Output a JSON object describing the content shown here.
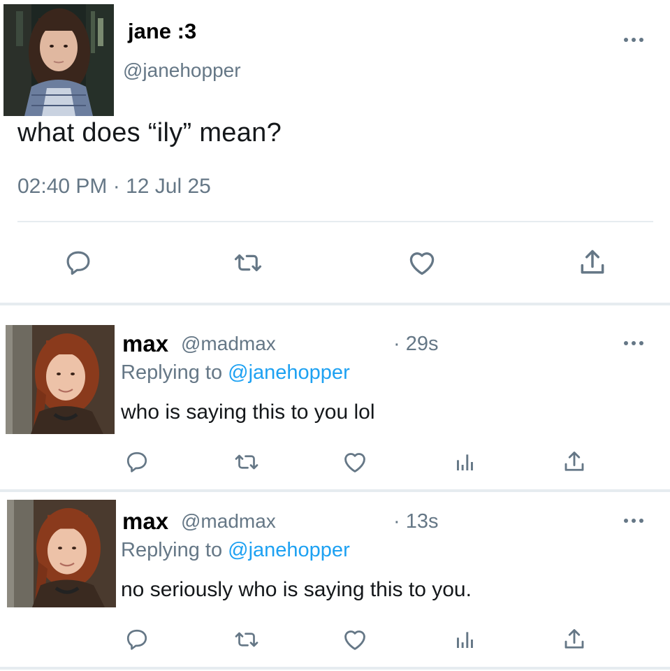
{
  "main_tweet": {
    "display_name": "jane :3",
    "handle": "@janehopper",
    "text": "what does “ily” mean?",
    "timestamp": "02:40 PM · 12 Jul 25",
    "more_icon": "more-dots-icon",
    "actions": [
      "reply-icon",
      "retweet-icon",
      "like-icon",
      "share-icon"
    ]
  },
  "replies": [
    {
      "display_name": "max",
      "handle": "@madmax",
      "time": "· 29s",
      "replying_prefix": "Replying to",
      "replying_handle": "@janehopper",
      "text": "who is saying this to you lol",
      "actions": [
        "reply-icon",
        "retweet-icon",
        "like-icon",
        "analytics-icon",
        "share-icon"
      ]
    },
    {
      "display_name": "max",
      "handle": "@madmax",
      "time": "· 13s",
      "replying_prefix": "Replying to",
      "replying_handle": "@janehopper",
      "text": "no seriously who is saying this to you.",
      "actions": [
        "reply-icon",
        "retweet-icon",
        "like-icon",
        "analytics-icon",
        "share-icon"
      ]
    }
  ],
  "colors": {
    "link": "#1da1f2",
    "secondary_text": "#657786",
    "divider": "#e6ecf0"
  }
}
